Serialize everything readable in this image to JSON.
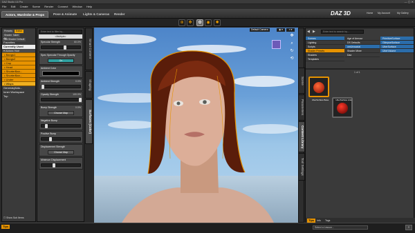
{
  "window": {
    "title": "DAZ Studio 4.6 Pro"
  },
  "menu": [
    "File",
    "Edit",
    "Create",
    "Scene",
    "Render",
    "Connect",
    "Window",
    "Help"
  ],
  "tabs": [
    "Actors, Wardrobe & Props",
    "Pose & Animate",
    "Lights & Cameras",
    "Render"
  ],
  "brand": {
    "logo": "DAZ 3D",
    "links": [
      "Home",
      "My Account",
      "My Gallery"
    ]
  },
  "left": {
    "subtabs": [
      "Presets",
      "Editor",
      "Shader Baker"
    ],
    "subtabs2": [
      "Shader",
      "3rd Shader Default"
    ],
    "categories": [
      "All",
      "Favorites",
      "Currently Used"
    ],
    "scene_items": [
      "Aldora Hair",
      "Bangs1",
      "Bangs2",
      "Cap",
      "Head",
      "ShorterBan...",
      "ShorterBan...",
      "Under",
      "Wisps"
    ],
    "groups": [
      "Genesis(Aldo...",
      "Inner Workspace",
      "Top"
    ],
    "show_sub_items": "Show Sub Items",
    "tips": "Tips"
  },
  "params": {
    "filter_placeholder": "Enter text to filter by...",
    "multiple": "<Multiple>",
    "items": [
      {
        "label": "Specular Strength",
        "value": "60.0%",
        "type": "slider",
        "pos": 0.6
      },
      {
        "label": "Spec Specular Through Opacity",
        "value": "",
        "type": "toggle",
        "state": "On"
      },
      {
        "label": "Ambient Color",
        "value": "",
        "type": "color"
      },
      {
        "label": "Ambient Strength",
        "value": "0.0%",
        "type": "slider",
        "pos": 0.0
      },
      {
        "label": "Opacity Strength",
        "value": "100.0%",
        "type": "slider",
        "pos": 1.0
      },
      {
        "label": "Bump Strength",
        "value": "0.0%",
        "type": "map",
        "btn": "Choose Map"
      },
      {
        "label": "Negative Bump",
        "value": "",
        "type": "slider",
        "pos": 0.1
      },
      {
        "label": "Positive Bump",
        "value": "",
        "type": "slider",
        "pos": 0.2
      },
      {
        "label": "Displacement Strength",
        "value": "",
        "type": "map",
        "btn": "Choose Map"
      },
      {
        "label": "Minimum Displacement",
        "value": "",
        "type": "slider",
        "pos": 0.3
      }
    ]
  },
  "midtabs": [
    "Smart Content",
    "Shaping",
    "Surfaces (Color)"
  ],
  "viewport": {
    "camera": "Default Camera"
  },
  "right": {
    "search_placeholder": "Enter text to search by...",
    "lib_col1": [
      "Scenes",
      "Lighting",
      "Scripts",
      "Shader Presets",
      "Shaders",
      "Templates"
    ],
    "lib_col2": [
      "Age of Armour",
      "DS Defaults",
      "omUnwaxial",
      "Shader Mixer",
      "Daz"
    ],
    "lib_col3": [
      "PrimitiveSurface",
      "GlimpseSurface",
      "UberSurface",
      "UberVolume"
    ],
    "pages": "1 of 1",
    "thumbs": [
      "UberSurface Base",
      "UberSurface Anis"
    ],
    "vtabs": [
      "Scene",
      "Parameters",
      "Content Library",
      "Tool Settings"
    ],
    "tips_tabs": [
      "Tips",
      "Info",
      "Tags"
    ]
  },
  "status": {
    "lesson": "Select a Lesson..."
  }
}
